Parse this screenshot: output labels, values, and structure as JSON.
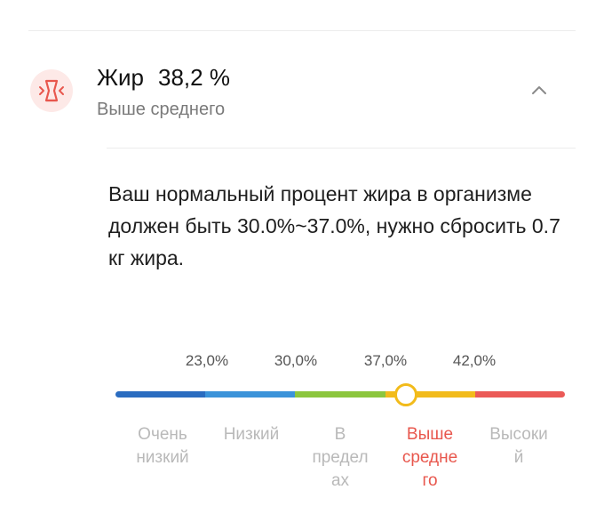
{
  "metric": {
    "icon": "waist-body-fat-icon",
    "label": "Жир",
    "value": "38,2 %",
    "status": "Выше среднего",
    "collapse_icon": "chevron-up-icon"
  },
  "description": "Ваш нормальный процент жира в организме должен быть 30.0%~37.0%, нужно сбросить 0.7 кг жира.",
  "scale": {
    "thresholds": [
      "23,0%",
      "30,0%",
      "37,0%",
      "42,0%"
    ],
    "ranges": [
      {
        "label": "Очень низкий",
        "lines": [
          "Очень",
          "низкий"
        ],
        "color": "#2a6cc0"
      },
      {
        "label": "Низкий",
        "lines": [
          "Низкий"
        ],
        "color": "#3b93d9"
      },
      {
        "label": "В пределах",
        "lines": [
          "В",
          "предел",
          "ах"
        ],
        "color": "#8cc63e"
      },
      {
        "label": "Выше среднего",
        "lines": [
          "Выше",
          "средне",
          "го"
        ],
        "color": "#f2bb1b"
      },
      {
        "label": "Высокий",
        "lines": [
          "Высоки",
          "й"
        ],
        "color": "#eb5a57"
      }
    ],
    "active_range": 3,
    "marker_position_pct": 64.6,
    "marker_color": "#f2bb1b",
    "active_text_color": "#e8574d"
  }
}
